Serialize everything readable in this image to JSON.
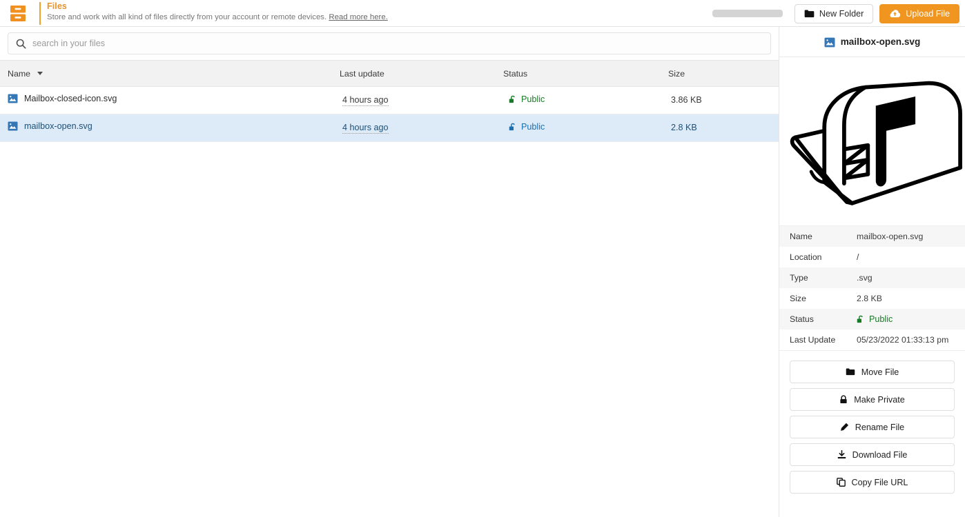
{
  "header": {
    "brand_icon": "file-cabinet-icon",
    "title": "Files",
    "subtitle": "Store and work with all kind of files directly from your account or remote devices.",
    "more_link": "Read more here.",
    "accent_color": "#f0951f"
  },
  "toolbar": {
    "placeholder_bar": "",
    "new_folder_label": "New Folder",
    "new_folder_icon": "folder-icon",
    "upload_label": "Upload File",
    "upload_icon": "cloud-upload-icon"
  },
  "search": {
    "icon": "search-icon",
    "placeholder": "search in your files",
    "value": ""
  },
  "table": {
    "columns": [
      {
        "key": "name",
        "label": "Name",
        "sorted": true,
        "sort_icon": "caret-down-icon"
      },
      {
        "key": "last_update",
        "label": "Last update"
      },
      {
        "key": "status",
        "label": "Status"
      },
      {
        "key": "size",
        "label": "Size"
      }
    ],
    "rows": [
      {
        "icon": "image-file-icon",
        "name": "Mailbox-closed-icon.svg",
        "last_update": "4 hours ago",
        "status": "Public",
        "status_icon": "unlock-icon",
        "status_color": "#1a7a26",
        "size": "3.86 KB",
        "selected": false
      },
      {
        "icon": "image-file-icon",
        "name": "mailbox-open.svg",
        "last_update": "4 hours ago",
        "status": "Public",
        "status_icon": "unlock-icon",
        "status_color": "#1d6fae",
        "size": "2.8 KB",
        "selected": true
      }
    ]
  },
  "panel": {
    "title": "mailbox-open.svg",
    "title_icon": "image-file-icon",
    "preview_alt": "mailbox-open-illustration",
    "metadata": [
      {
        "key": "Name",
        "value": "mailbox-open.svg"
      },
      {
        "key": "Location",
        "value": "/"
      },
      {
        "key": "Type",
        "value": ".svg"
      },
      {
        "key": "Size",
        "value": "2.8 KB"
      },
      {
        "key": "Status",
        "value": "Public",
        "icon": "unlock-icon"
      },
      {
        "key": "Last Update",
        "value": "05/23/2022 01:33:13 pm"
      }
    ],
    "actions": [
      {
        "label": "Move File",
        "icon": "folder-icon"
      },
      {
        "label": "Make Private",
        "icon": "lock-icon"
      },
      {
        "label": "Rename File",
        "icon": "pencil-icon"
      },
      {
        "label": "Download File",
        "icon": "download-icon"
      },
      {
        "label": "Copy File URL",
        "icon": "copy-icon"
      }
    ]
  }
}
